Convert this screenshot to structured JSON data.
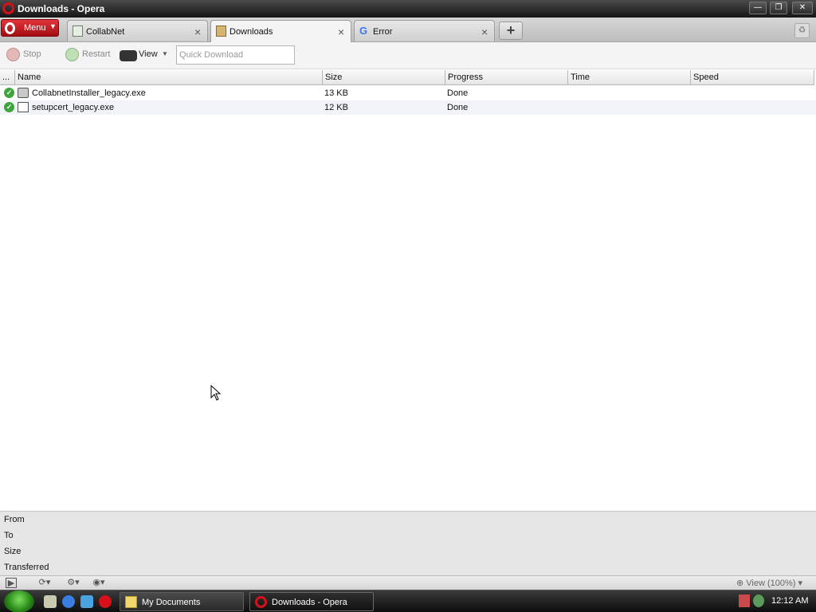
{
  "window": {
    "title": "Downloads - Opera"
  },
  "menu": {
    "label": "Menu"
  },
  "tabs": [
    {
      "label": "CollabNet"
    },
    {
      "label": "Downloads"
    },
    {
      "label": "Error"
    }
  ],
  "toolbar": {
    "stop_label": "Stop",
    "restart_label": "Restart",
    "view_label": "View",
    "quick_download_placeholder": "Quick Download"
  },
  "columns": {
    "more": "...",
    "name": "Name",
    "size": "Size",
    "progress": "Progress",
    "time": "Time",
    "speed": "Speed"
  },
  "downloads": [
    {
      "name": "CollabnetInstaller_legacy.exe",
      "size": "13 KB",
      "progress": "Done",
      "time": "",
      "speed": ""
    },
    {
      "name": "setupcert_legacy.exe",
      "size": "12 KB",
      "progress": "Done",
      "time": "",
      "speed": ""
    }
  ],
  "details": {
    "from_label": "From",
    "to_label": "To",
    "size_label": "Size",
    "transferred_label": "Transferred"
  },
  "statusbar": {
    "zoom_label": "View (100%)"
  },
  "taskbar": {
    "items": [
      {
        "label": "My Documents"
      },
      {
        "label": "Downloads - Opera"
      }
    ],
    "clock": "12:12 AM"
  },
  "colors": {
    "opera_red": "#d8101a",
    "done_green": "#3ea53a"
  }
}
